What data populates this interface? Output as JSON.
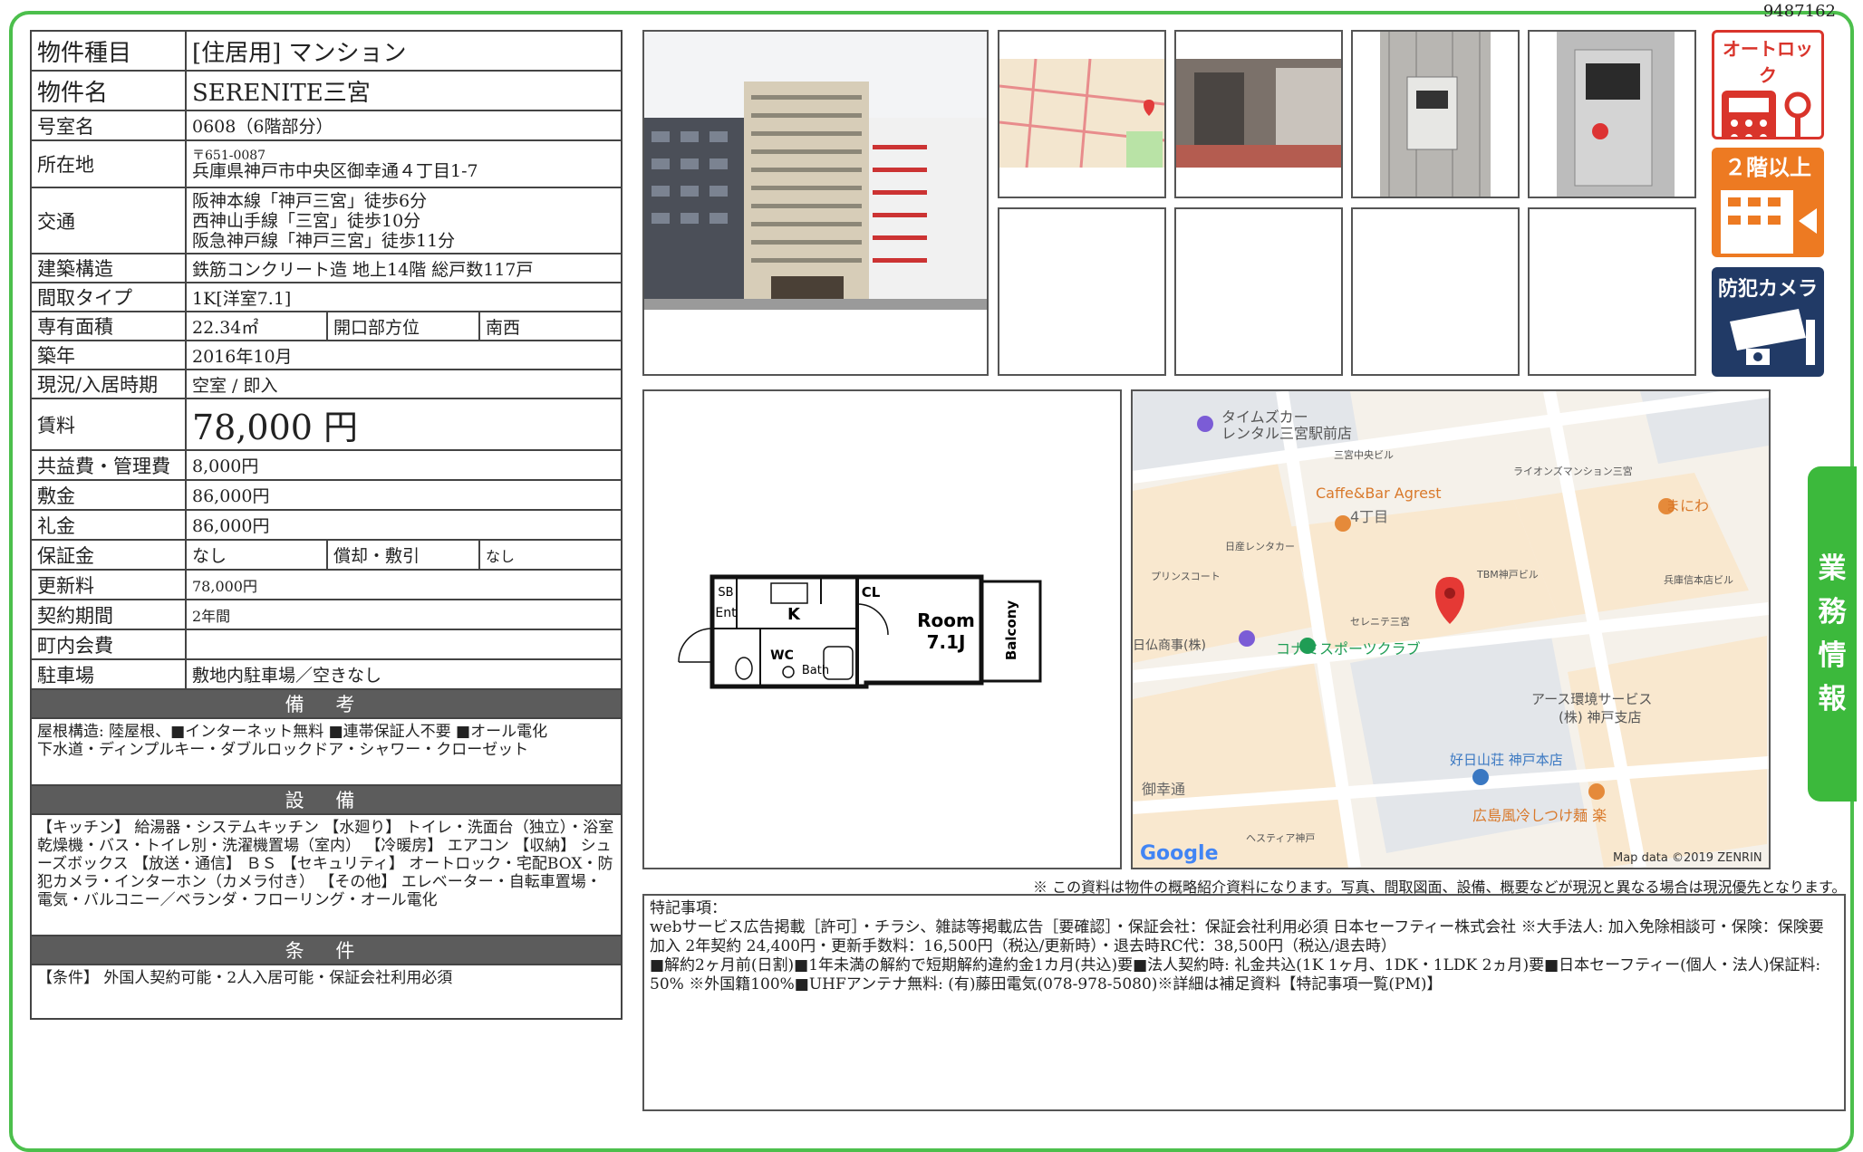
{
  "doc_id": "9487162",
  "side_tab": [
    "業",
    "務",
    "情",
    "報"
  ],
  "spec": {
    "type_label": "物件種目",
    "type_value": "[住居用] マンション",
    "name_label": "物件名",
    "name_value": "SERENITE三宮",
    "room_label": "号室名",
    "room_value": "0608（6階部分）",
    "address_label": "所在地",
    "postal": "〒651-0087",
    "address": "兵庫県神戸市中央区御幸通４丁目1-7",
    "access_label": "交通",
    "access": [
      "阪神本線「神戸三宮」徒歩6分",
      "西神山手線「三宮」徒歩10分",
      "阪急神戸線「神戸三宮」徒歩11分"
    ],
    "structure_label": "建築構造",
    "structure_value": "鉄筋コンクリート造 地上14階 総戸数117戸",
    "layout_label": "間取タイプ",
    "layout_value": "1K[洋室7.1]",
    "area_label": "専有面積",
    "area_value": "22.34㎡",
    "facing_label": "開口部方位",
    "facing_value": "南西",
    "built_label": "築年",
    "built_value": "2016年10月",
    "status_label": "現況/入居時期",
    "status_value": "空室 / 即入",
    "rent_label": "賃料",
    "rent_value": "78,000 円",
    "fee_label": "共益費・管理費",
    "fee_value": "8,000円",
    "deposit_label": "敷金",
    "deposit_value": "86,000円",
    "key_label": "礼金",
    "key_value": "86,000円",
    "guarantee_label": "保証金",
    "guarantee_value": "なし",
    "amort_label": "償却・敷引",
    "amort_value": "なし",
    "renewal_label": "更新料",
    "renewal_value": "78,000円",
    "term_label": "契約期間",
    "term_value": "2年間",
    "assoc_label": "町内会費",
    "assoc_value": "",
    "parking_label": "駐車場",
    "parking_value": "敷地内駐車場／空きなし"
  },
  "sections": {
    "remarks_title": "備 考",
    "remarks_text": "屋根構造: 陸屋根、■インターネット無料 ■連帯保証人不要 ■オール電化\n下水道・ディンプルキー・ダブルロックドア・シャワー・クローゼット",
    "equipment_title": "設 備",
    "equipment_text": "【キッチン】 給湯器・システムキッチン 【水廻り】 トイレ・洗面台（独立）・浴室乾燥機・バス・トイレ別・洗濯機置場（室内） 【冷暖房】 エアコン 【収納】 シューズボックス 【放送・通信】 ＢＳ 【セキュリティ】 オートロック・宅配BOX・防犯カメラ・インターホン（カメラ付き） 【その他】 エレベーター・自転車置場・電気・バルコニー／ベランダ・フローリング・オール電化",
    "conditions_title": "条 件",
    "conditions_text": "【条件】 外国人契約可能・2人入居可能・保証会社利用必須"
  },
  "badges": {
    "autolock": "オートロック",
    "floor": "２階以上",
    "camera": "防犯カメラ"
  },
  "floorplan": {
    "room": "Room",
    "room_size": "7.1J",
    "balcony": "Balcony",
    "labels": [
      "SB",
      "CL",
      "Ent",
      "K",
      "WC",
      "Bath"
    ]
  },
  "map": {
    "labels": [
      {
        "text": "タイムズカー",
        "color": "#555"
      },
      {
        "text": "レンタル三宮駅前店",
        "color": "#555"
      },
      {
        "text": "三宮中央ビル",
        "color": "#555"
      },
      {
        "text": "ライオンズマンション三宮",
        "color": "#555"
      },
      {
        "text": "Caffe&Bar Agrest",
        "color": "#d9792b"
      },
      {
        "text": "まにわ",
        "color": "#d9792b"
      },
      {
        "text": "4丁目",
        "color": "#666"
      },
      {
        "text": "日産レンタカー",
        "color": "#555"
      },
      {
        "text": "プリンスコート",
        "color": "#555"
      },
      {
        "text": "TBM神戸ビル",
        "color": "#555"
      },
      {
        "text": "兵庫信本店ビル",
        "color": "#555"
      },
      {
        "text": "セレニテ三宮",
        "color": "#555"
      },
      {
        "text": "コナミスポーツクラブ",
        "color": "#1f9d55"
      },
      {
        "text": "日仏商事(株)",
        "color": "#555"
      },
      {
        "text": "アース環境サービス",
        "color": "#555"
      },
      {
        "text": "(株) 神戸支店",
        "color": "#555"
      },
      {
        "text": "好日山荘 神戸本店",
        "color": "#3a78c2"
      },
      {
        "text": "御幸通",
        "color": "#666"
      },
      {
        "text": "広島風冷しつけ麺 楽",
        "color": "#d9792b"
      },
      {
        "text": "ヘスティア神戸",
        "color": "#555"
      }
    ],
    "google": "Google",
    "credit": "Map data ©2019 ZENRIN"
  },
  "caption": "※ この資料は物件の概略紹介資料になります。写真、間取図面、設備、概要などが現況と異なる場合は現況優先となります。",
  "special": {
    "title": "特記事項：",
    "text": "webサービス広告掲載［許可］・チラシ、雑誌等掲載広告［要確認］・保証会社：保証会社利用必須 日本セーフティー株式会社 ※大手法人: 加入免除相談可・保険：保険要加入 2年契約 24,400円・更新手数料：16,500円（税込/更新時）・退去時RC代：38,500円（税込/退去時）\n■解約2ヶ月前(日割)■1年未満の解約で短期解約違約金1カ月(共込)要■法人契約時: 礼金共込(1K 1ヶ月、1DK・1LDK 2ヵ月)要■日本セーフティー(個人・法人)保証料: 50% ※外国籍100%■UHFアンテナ無料: (有)藤田電気(078-978-5080)※詳細は補足資料【特記事項一覧(PM)】"
  }
}
